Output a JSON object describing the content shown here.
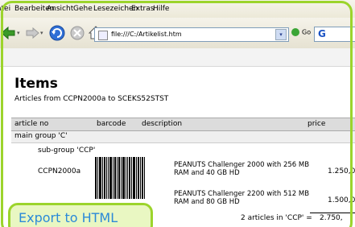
{
  "menu": [
    "atei",
    "Bearbeiten",
    "Ansicht",
    "Gehe",
    "Lesezeichen",
    "Extras",
    "Hilfe"
  ],
  "address": {
    "url": "file:///C:/Artikelist.htm",
    "go_label": "Go",
    "search_letter": "G"
  },
  "page": {
    "title": "Items",
    "subtitle": "Articles from CCPN2000a   to SCEKS52STST",
    "columns": [
      "article no",
      "barcode",
      "description",
      "price"
    ],
    "group_label": "main group 'C'",
    "subgroup_label": "sub-group 'CCP'",
    "rows": [
      {
        "article": "CCPN2000a",
        "description": "PEANUTS Challenger 2000 with 256 MB RAM and 40 GB HD",
        "price": "1.250,0"
      },
      {
        "article": "",
        "description": "PEANUTS Challenger 2200 with 512 MB RAM and 80 GB HD",
        "price": "1.500,0"
      }
    ],
    "summary": "2 articles in 'CCP' =",
    "summary_value": "2.750,"
  },
  "overlay": {
    "export_label": "Export to HTML"
  },
  "colors": {
    "accent_green": "#9cd42c",
    "export_text": "#2b8ad8"
  },
  "icons": [
    "back-icon",
    "forward-icon",
    "reload-icon",
    "stop-icon",
    "home-icon",
    "page-icon",
    "go-icon",
    "search-icon"
  ]
}
